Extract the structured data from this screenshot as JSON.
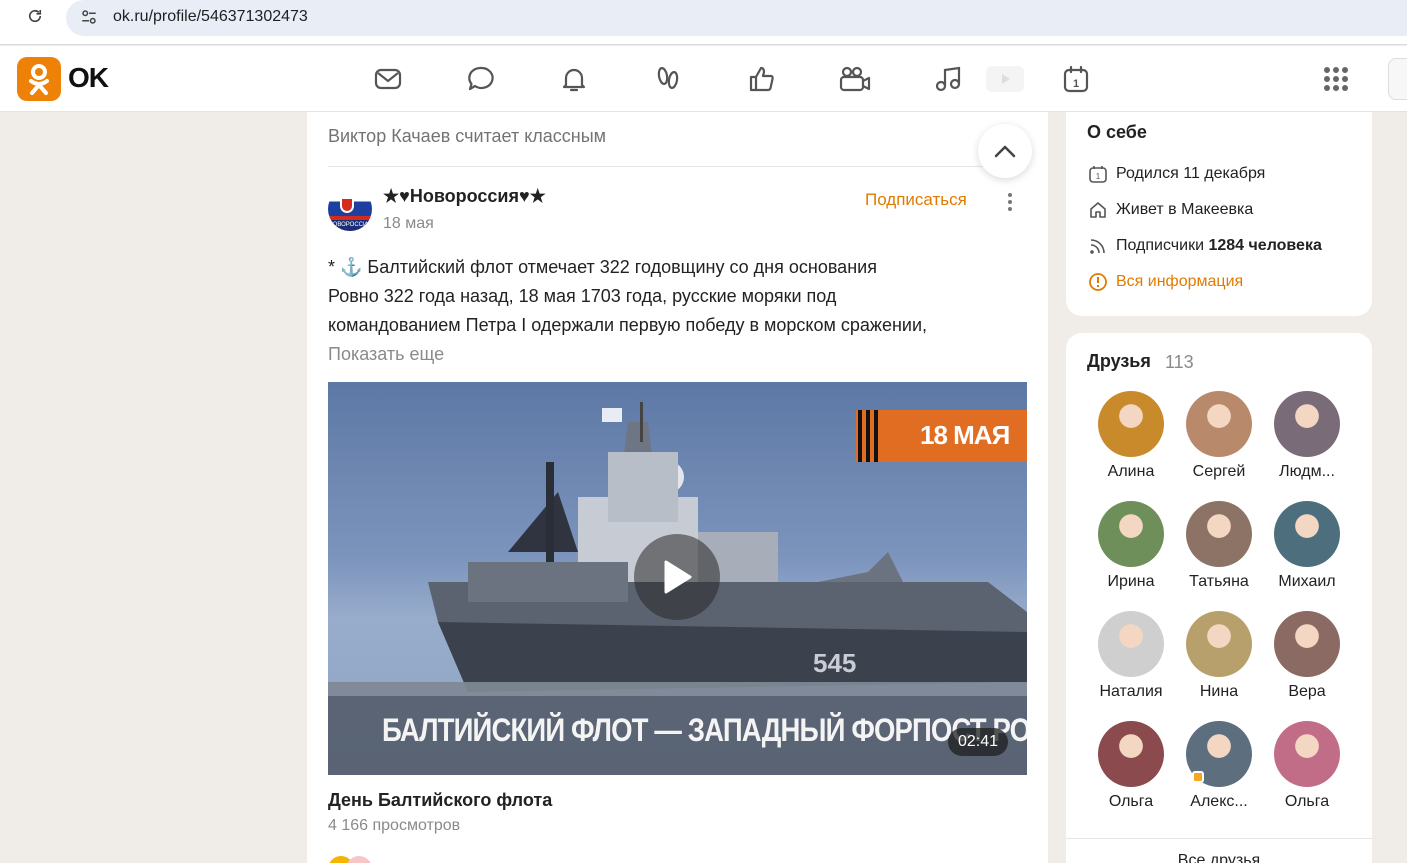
{
  "browser": {
    "url": "ok.ru/profile/546371302473"
  },
  "header": {
    "logo_text": "OK",
    "nav_icons": [
      "mail-icon",
      "chat-icon",
      "bell-icon",
      "guests-icon",
      "like-icon",
      "video-camera-icon",
      "music-icon",
      "games-icon",
      "calendar-icon",
      "apps-grid-icon"
    ]
  },
  "feed": {
    "activity_text": "Виктор Качаев считает классным",
    "post": {
      "group_name": "★♥Новороссия♥★",
      "avatar_label": "НОВОРОССИЯ",
      "date": "18 мая",
      "subscribe_label": "Подписаться",
      "text_lines": [
        "* ⚓ Балтийский флот отмечает 322 годовщину со дня основания",
        "Ровно 322 года назад, 18 мая 1703 года, русские моряки под",
        "командованием Петра I одержали первую победу в морском сражении,"
      ],
      "show_more": "Показать еще",
      "video": {
        "banner_text": "18 МАЯ",
        "hull_number": "545",
        "caption": "БАЛТИЙСКИЙ ФЛОТ — ЗАПАДНЫЙ ФОРПОСТ РОССИИ",
        "duration": "02:41"
      },
      "video_title": "День Балтийского флота",
      "views": "4 166 просмотров"
    }
  },
  "about": {
    "title": "О себе",
    "birthday": "Родился 11 декабря",
    "lives": "Живет в Макеевка",
    "followers_prefix": "Подписчики",
    "followers_value": "1284 человека",
    "all_info": "Вся информация"
  },
  "friends": {
    "title": "Друзья",
    "count": "113",
    "items": [
      {
        "name": "Алина",
        "color": "#c98a2c"
      },
      {
        "name": "Сергей",
        "color": "#b9896b"
      },
      {
        "name": "Людм...",
        "color": "#7a6b78"
      },
      {
        "name": "Ирина",
        "color": "#6f8f5a"
      },
      {
        "name": "Татьяна",
        "color": "#8c7366"
      },
      {
        "name": "Михаил",
        "color": "#4d6f7d"
      },
      {
        "name": "Наталия",
        "color": "#cfcfcf"
      },
      {
        "name": "Нина",
        "color": "#b7a06b"
      },
      {
        "name": "Вера",
        "color": "#8a6a62"
      },
      {
        "name": "Ольга",
        "color": "#8a4a4e"
      },
      {
        "name": "Алекс...",
        "color": "#5d6e7f"
      },
      {
        "name": "Ольга",
        "color": "#c26d87"
      }
    ],
    "all_label": "Все друзья"
  },
  "colors": {
    "accent": "#ee8208",
    "link": "#e07b00",
    "background": "#f0ede9"
  }
}
